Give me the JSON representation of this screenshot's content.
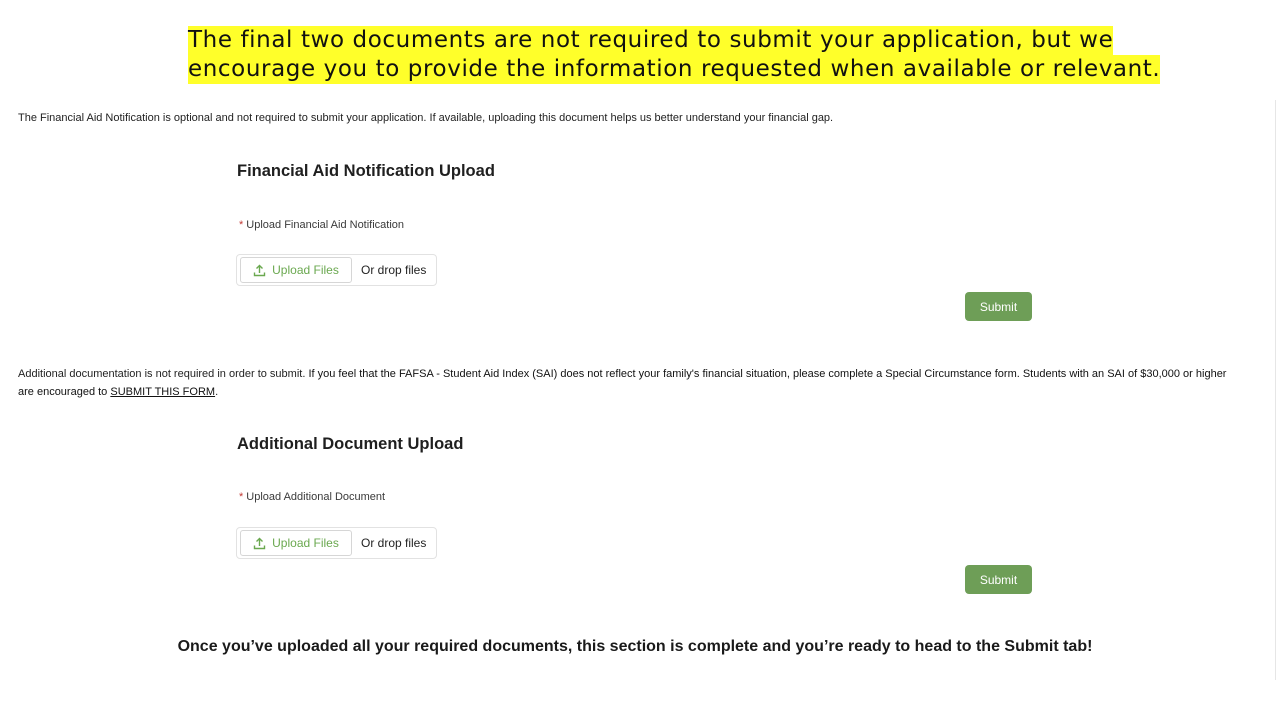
{
  "banner": {
    "line1": "The final two documents are not required to submit your application, but we",
    "line2": "encourage you to provide the information requested when available or relevant.",
    "highlight_color": "#ffff2a"
  },
  "section1": {
    "intro": "The Financial Aid Notification is optional and not required to submit your application. If available, uploading this document helps us better understand your financial gap.",
    "title": "Financial Aid Notification Upload",
    "required_mark": "*",
    "field_label": "Upload Financial Aid Notification",
    "upload_button": "Upload Files",
    "upload_icon": "upload-icon",
    "drop_text": "Or drop files",
    "submit_label": "Submit"
  },
  "section2": {
    "intro_part1": "Additional documentation is not required in order to submit.",
    "intro_part2": " If you feel that the FAFSA - Student Aid Index (SAI) does not reflect your family's financial situation, please complete a Special Circumstance form. Students with an SAI of $30,000 or higher are encouraged to ",
    "link_text": "SUBMIT THIS FORM",
    "intro_end": ".",
    "title": "Additional Document Upload",
    "required_mark": "*",
    "field_label": "Upload Additional Document",
    "upload_button": "Upload Files",
    "upload_icon": "upload-icon",
    "drop_text": "Or drop files",
    "submit_label": "Submit"
  },
  "footer": {
    "message": "Once you’ve uploaded all your required documents, this section is complete and you’re ready to head to the Submit tab!"
  },
  "colors": {
    "accent_green": "#6e9e57",
    "upload_text_green": "#6aa84f",
    "required_red": "#c23934"
  }
}
